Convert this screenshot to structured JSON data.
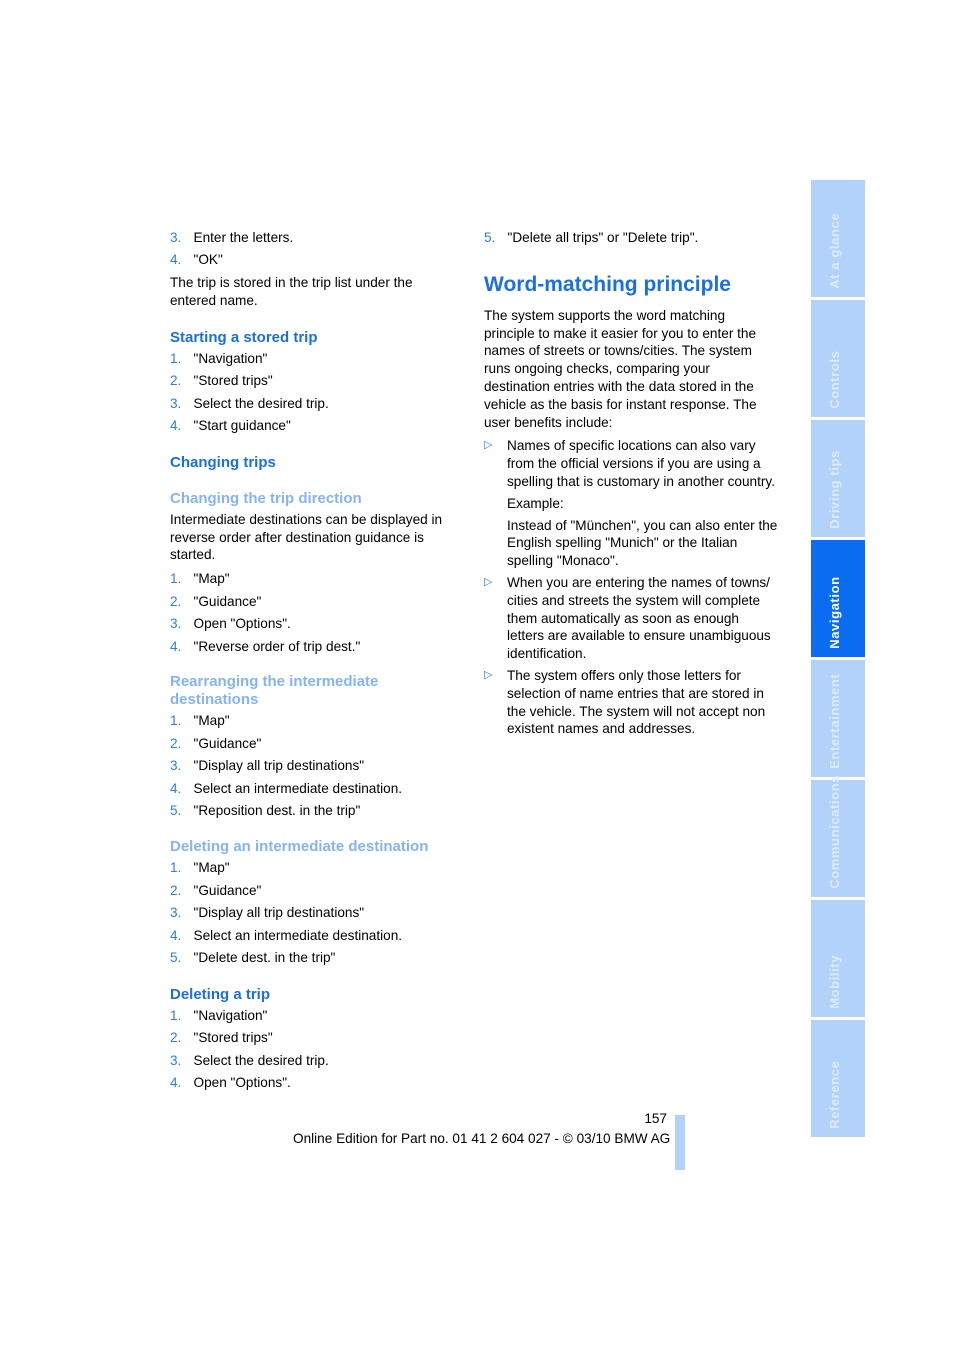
{
  "left_column": {
    "intro_steps": [
      {
        "num": "3.",
        "text": "Enter the letters."
      },
      {
        "num": "4.",
        "text": "\"OK\""
      }
    ],
    "intro_para": "The trip is stored in the trip list under the entered name.",
    "starting": {
      "heading": "Starting a stored trip",
      "steps": [
        {
          "num": "1.",
          "text": "\"Navigation\""
        },
        {
          "num": "2.",
          "text": "\"Stored trips\""
        },
        {
          "num": "3.",
          "text": "Select the desired trip."
        },
        {
          "num": "4.",
          "text": "\"Start guidance\""
        }
      ]
    },
    "changing": {
      "heading": "Changing trips"
    },
    "direction": {
      "heading": "Changing the trip direction",
      "para": "Intermediate destinations can be displayed in reverse order after destination guidance is started.",
      "steps": [
        {
          "num": "1.",
          "text": "\"Map\""
        },
        {
          "num": "2.",
          "text": "\"Guidance\""
        },
        {
          "num": "3.",
          "text": "Open \"Options\"."
        },
        {
          "num": "4.",
          "text": "\"Reverse order of trip dest.\""
        }
      ]
    },
    "rearranging": {
      "heading": "Rearranging the intermediate destinations",
      "steps": [
        {
          "num": "1.",
          "text": "\"Map\""
        },
        {
          "num": "2.",
          "text": "\"Guidance\""
        },
        {
          "num": "3.",
          "text": "\"Display all trip destinations\""
        },
        {
          "num": "4.",
          "text": "Select an intermediate destination."
        },
        {
          "num": "5.",
          "text": "\"Reposition dest. in the trip\""
        }
      ]
    },
    "deleting_dest": {
      "heading": "Deleting an intermediate destination",
      "steps": [
        {
          "num": "1.",
          "text": "\"Map\""
        },
        {
          "num": "2.",
          "text": "\"Guidance\""
        },
        {
          "num": "3.",
          "text": "\"Display all trip destinations\""
        },
        {
          "num": "4.",
          "text": "Select an intermediate destination."
        },
        {
          "num": "5.",
          "text": "\"Delete dest. in the trip\""
        }
      ]
    },
    "deleting_trip": {
      "heading": "Deleting a trip",
      "steps": [
        {
          "num": "1.",
          "text": "\"Navigation\""
        },
        {
          "num": "2.",
          "text": "\"Stored trips\""
        },
        {
          "num": "3.",
          "text": "Select the desired trip."
        },
        {
          "num": "4.",
          "text": "Open \"Options\"."
        }
      ]
    }
  },
  "right_column": {
    "top_step": {
      "num": "5.",
      "text": "\"Delete all trips\" or \"Delete trip\"."
    },
    "heading": "Word-matching principle",
    "para": "The system supports the word matching principle to make it easier for you to enter the names of streets or towns/cities. The system runs ongoing checks, comparing your destination entries with the data stored in the vehicle as the basis for instant response. The user benefits include:",
    "bullet_icon": "triangle-right-icon",
    "bullets": [
      {
        "text": "Names of specific locations can also vary from the official versions if you are using a spelling that is customary in another country.",
        "example_label": "Example:",
        "example_text": "Instead of \"München\", you can also enter the English spelling \"Munich\" or the Italian spelling \"Monaco\"."
      },
      {
        "text": "When you are entering the names of towns/ cities and streets the system will complete them automatically as soon as enough letters are available to ensure unambiguous identification."
      },
      {
        "text": "The system offers only those letters for selection of name entries that are stored in the vehicle. The system will not accept non existent names and addresses."
      }
    ]
  },
  "side_tabs": [
    {
      "label": "At a glance",
      "active": false
    },
    {
      "label": "Controls",
      "active": false
    },
    {
      "label": "Driving tips",
      "active": false
    },
    {
      "label": "Navigation",
      "active": true
    },
    {
      "label": "Entertainment",
      "active": false
    },
    {
      "label": "Communications",
      "active": false
    },
    {
      "label": "Mobility",
      "active": false
    },
    {
      "label": "Reference",
      "active": false
    }
  ],
  "footer": {
    "page_number": "157",
    "edition_text": "Online Edition for Part no. 01 41 2 604 027 - © 03/10 BMW AG"
  },
  "colors": {
    "heading_blue": "#1a6fe6",
    "subheading_light_blue": "#84b4f4",
    "tab_inactive": "#b3d2fa",
    "tab_active": "#0a6cf0"
  }
}
